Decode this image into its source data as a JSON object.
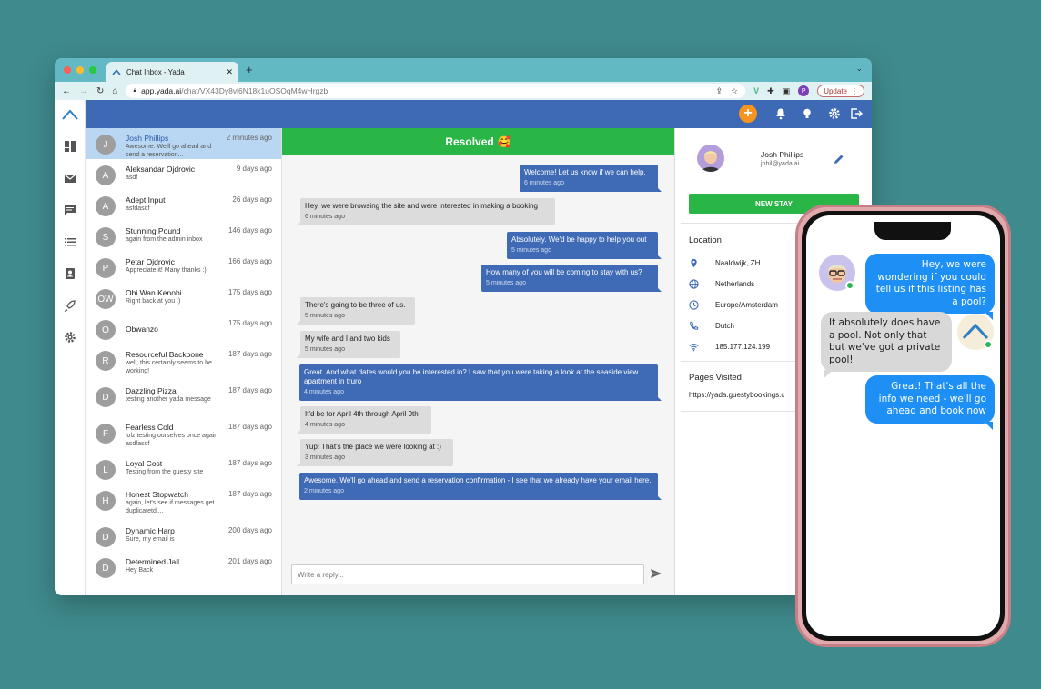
{
  "colors": {
    "background": "#3f8a8c",
    "accent": "#3e69b4",
    "success": "#29b646",
    "orange": "#f7941d",
    "phone_bubble": "#1e90f5"
  },
  "browser": {
    "tab_title": "Chat Inbox - Yada",
    "url_host": "app.yada.ai",
    "url_path": "/chat/VX43Dy8vl6N18k1uOSOqM4wHrgzb",
    "profile_initial": "P",
    "update_label": "Update"
  },
  "rail": {
    "icons": [
      "dashboard-icon",
      "mail-icon",
      "chat-icon",
      "list-icon",
      "contacts-icon",
      "rocket-icon",
      "settings-icon"
    ]
  },
  "conversations": [
    {
      "initial": "J",
      "name": "Josh Phillips",
      "preview": "Awesome. We'll go ahead and send a reservation...",
      "time": "2 minutes ago",
      "selected": true
    },
    {
      "initial": "A",
      "name": "Aleksandar Ojdrovic",
      "preview": "asdf",
      "time": "9 days ago"
    },
    {
      "initial": "A",
      "name": "Adept Input",
      "preview": "asfdasdf",
      "time": "26 days ago"
    },
    {
      "initial": "S",
      "name": "Stunning Pound",
      "preview": "again from the admin inbox",
      "time": "146 days ago"
    },
    {
      "initial": "P",
      "name": "Petar Ojdrovic",
      "preview": "Appreciate it! Many thanks :)",
      "time": "166 days ago"
    },
    {
      "initial": "OW",
      "name": "Obi Wan Kenobi",
      "preview": "Right back at you :)",
      "time": "175 days ago"
    },
    {
      "initial": "O",
      "name": "Obwanzo",
      "preview": "",
      "time": "175 days ago"
    },
    {
      "initial": "R",
      "name": "Resourceful Backbone",
      "preview": "well, this certainly seems to be working!",
      "time": "187 days ago"
    },
    {
      "initial": "D",
      "name": "Dazzling Pizza",
      "preview": "testing another yada message",
      "time": "187 days ago"
    },
    {
      "initial": "F",
      "name": "Fearless Cold",
      "preview": "lolz testing ourselves once again asdfasdf",
      "time": "187 days ago"
    },
    {
      "initial": "L",
      "name": "Loyal Cost",
      "preview": "Testing from the guesty site",
      "time": "187 days ago"
    },
    {
      "initial": "H",
      "name": "Honest Stopwatch",
      "preview": "again, let's see if messages get duplicatetd....",
      "time": "187 days ago"
    },
    {
      "initial": "D",
      "name": "Dynamic Harp",
      "preview": "Sure, my email is",
      "time": "200 days ago"
    },
    {
      "initial": "D",
      "name": "Determined Jail",
      "preview": "Hey Back",
      "time": "201 days ago"
    }
  ],
  "chat": {
    "status": "Resolved",
    "status_emoji": "🥰",
    "messages": [
      {
        "dir": "out",
        "text": "Welcome! Let us know if we can help.",
        "time": "6 minutes ago"
      },
      {
        "dir": "in",
        "text": "Hey, we were browsing the site and were interested in making a booking",
        "time": "6 minutes ago"
      },
      {
        "dir": "out",
        "text": "Absolutely. We'd be happy to help you out",
        "time": "5 minutes ago"
      },
      {
        "dir": "out",
        "text": "How many of you will be coming to stay with us?",
        "time": "5 minutes ago"
      },
      {
        "dir": "in",
        "text": "There's going to be three of us.",
        "time": "5 minutes ago"
      },
      {
        "dir": "in",
        "text": "My wife and I and two kids",
        "time": "5 minutes ago"
      },
      {
        "dir": "out",
        "text": "Great. And what dates would you be interested in? I saw that you were taking a look at the seaside view apartment in truro",
        "time": "4 minutes ago"
      },
      {
        "dir": "in",
        "text": "It'd be for April 4th through April 9th",
        "time": "4 minutes ago"
      },
      {
        "dir": "in",
        "text": "Yup! That's the place we were looking at :)",
        "time": "3 minutes ago"
      },
      {
        "dir": "out",
        "text": "Awesome. We'll go ahead and send a reservation confirmation - I see that we already have your email here.",
        "time": "2 minutes ago"
      }
    ],
    "reply_placeholder": "Write a reply..."
  },
  "contact": {
    "name": "Josh Phillips",
    "email": "jphil@yada.ai",
    "new_stay_label": "NEW STAY",
    "location_heading": "Location",
    "city": "Naaldwijk, ZH",
    "country": "Netherlands",
    "timezone": "Europe/Amsterdam",
    "language": "Dutch",
    "ip": "185.177.124.199",
    "pages_heading": "Pages Visited",
    "page_url": "https://yada.guestybookings.c"
  },
  "phone": {
    "messages": [
      {
        "dir": "out",
        "text": "Hey, we were wondering if you could tell us if this listing has a pool?"
      },
      {
        "dir": "in",
        "text": "It absolutely does have a pool. Not only that but we've got a private pool!"
      },
      {
        "dir": "out",
        "text": "Great! That's all the info we need - we'll go ahead and book now"
      }
    ]
  }
}
